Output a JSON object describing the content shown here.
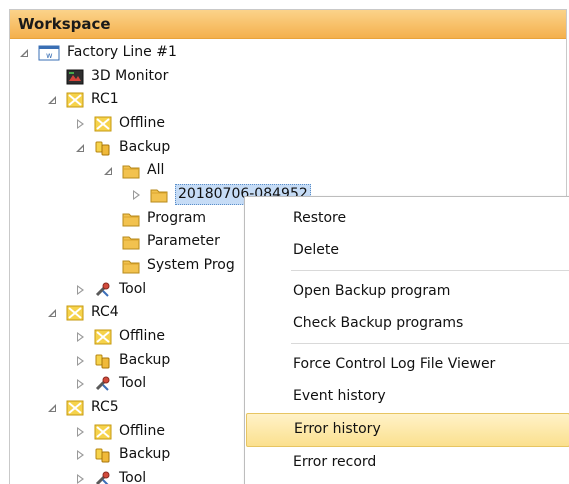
{
  "panel": {
    "title": "Workspace"
  },
  "tree": [
    {
      "label": "Factory Line #1",
      "icon": "factory-line-icon",
      "expander": "open"
    },
    {
      "label": "3D Monitor",
      "icon": "3d-monitor-icon",
      "expander": "none"
    },
    {
      "label": "RC1",
      "icon": "controller-icon",
      "expander": "open"
    },
    {
      "label": "Offline",
      "icon": "offline-icon",
      "expander": "collapsed"
    },
    {
      "label": "Backup",
      "icon": "backup-icon",
      "expander": "open"
    },
    {
      "label": "All",
      "icon": "folder-icon",
      "expander": "open"
    },
    {
      "label": "20180706-084952",
      "icon": "folder-icon",
      "expander": "collapsed",
      "selected": true
    },
    {
      "label": "Program",
      "icon": "folder-icon",
      "expander": "none"
    },
    {
      "label": "Parameter",
      "icon": "folder-icon",
      "expander": "none"
    },
    {
      "label": "System Prog",
      "icon": "folder-icon",
      "expander": "none"
    },
    {
      "label": "Tool",
      "icon": "tool-icon",
      "expander": "collapsed"
    },
    {
      "label": "RC4",
      "icon": "controller-icon",
      "expander": "open"
    },
    {
      "label": "Offline",
      "icon": "offline-icon",
      "expander": "collapsed"
    },
    {
      "label": "Backup",
      "icon": "backup-icon",
      "expander": "collapsed"
    },
    {
      "label": "Tool",
      "icon": "tool-icon",
      "expander": "collapsed"
    },
    {
      "label": "RC5",
      "icon": "controller-icon",
      "expander": "open"
    },
    {
      "label": "Offline",
      "icon": "offline-icon",
      "expander": "collapsed"
    },
    {
      "label": "Backup",
      "icon": "backup-icon",
      "expander": "collapsed"
    },
    {
      "label": "Tool",
      "icon": "tool-icon",
      "expander": "collapsed"
    }
  ],
  "context_menu": {
    "items": [
      {
        "label": "Restore"
      },
      {
        "label": "Delete"
      },
      {
        "label": "Open Backup program"
      },
      {
        "label": "Check Backup programs"
      },
      {
        "label": "Force Control Log File Viewer"
      },
      {
        "label": "Event history"
      },
      {
        "label": "Error history",
        "highlighted": true
      },
      {
        "label": "Error record"
      }
    ]
  },
  "colors": {
    "header_gradient": [
      "#fbd38a",
      "#f4b04d"
    ],
    "selection": "#c6dcf6",
    "menu_highlight": "#fbe08e"
  }
}
